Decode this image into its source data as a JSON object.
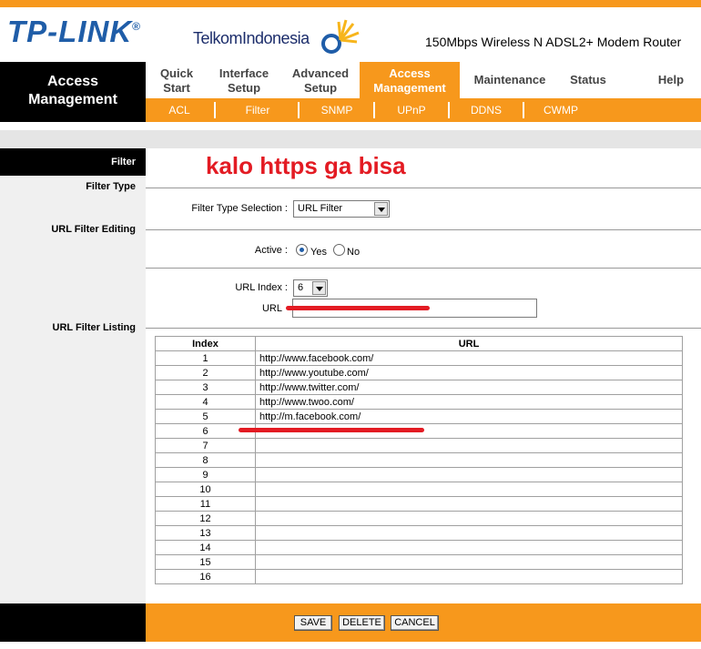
{
  "header": {
    "brand": "TP-LINK",
    "brand_mark": "®",
    "partner": "TelkomIndonesia",
    "model": "150Mbps Wireless N ADSL2+ Modem Router"
  },
  "nav": {
    "section_title_line1": "Access",
    "section_title_line2": "Management",
    "tabs": [
      {
        "l1": "Quick",
        "l2": "Start"
      },
      {
        "l1": "Interface",
        "l2": "Setup"
      },
      {
        "l1": "Advanced",
        "l2": "Setup"
      },
      {
        "l1": "Access",
        "l2": "Management"
      },
      {
        "l1": "Maintenance",
        "l2": ""
      },
      {
        "l1": "Status",
        "l2": ""
      },
      {
        "l1": "Help",
        "l2": ""
      }
    ],
    "subtabs": [
      "ACL",
      "Filter",
      "SNMP",
      "UPnP",
      "DDNS",
      "CWMP"
    ]
  },
  "annotation": "kalo https ga bisa",
  "sections": {
    "filter": "Filter",
    "filter_type": "Filter Type",
    "url_filter_editing": "URL Filter Editing",
    "url_filter_listing": "URL Filter Listing"
  },
  "form": {
    "filter_type_label": "Filter Type Selection :",
    "filter_type_value": "URL Filter",
    "active_label": "Active :",
    "yes_label": "Yes",
    "no_label": "No",
    "url_index_label": "URL Index :",
    "url_index_value": "6",
    "url_label": "URL"
  },
  "table": {
    "col_index": "Index",
    "col_url": "URL",
    "rows": [
      {
        "index": "1",
        "url": "http://www.facebook.com/"
      },
      {
        "index": "2",
        "url": "http://www.youtube.com/"
      },
      {
        "index": "3",
        "url": "http://www.twitter.com/"
      },
      {
        "index": "4",
        "url": "http://www.twoo.com/"
      },
      {
        "index": "5",
        "url": "http://m.facebook.com/"
      },
      {
        "index": "6",
        "url": ""
      },
      {
        "index": "7",
        "url": ""
      },
      {
        "index": "8",
        "url": ""
      },
      {
        "index": "9",
        "url": ""
      },
      {
        "index": "10",
        "url": ""
      },
      {
        "index": "11",
        "url": ""
      },
      {
        "index": "12",
        "url": ""
      },
      {
        "index": "13",
        "url": ""
      },
      {
        "index": "14",
        "url": ""
      },
      {
        "index": "15",
        "url": ""
      },
      {
        "index": "16",
        "url": ""
      }
    ]
  },
  "buttons": {
    "save": "SAVE",
    "delete": "DELETE",
    "cancel": "CANCEL"
  },
  "colors": {
    "accent": "#f7981c",
    "brand": "#1f5da8",
    "annotation": "#e31b23"
  }
}
